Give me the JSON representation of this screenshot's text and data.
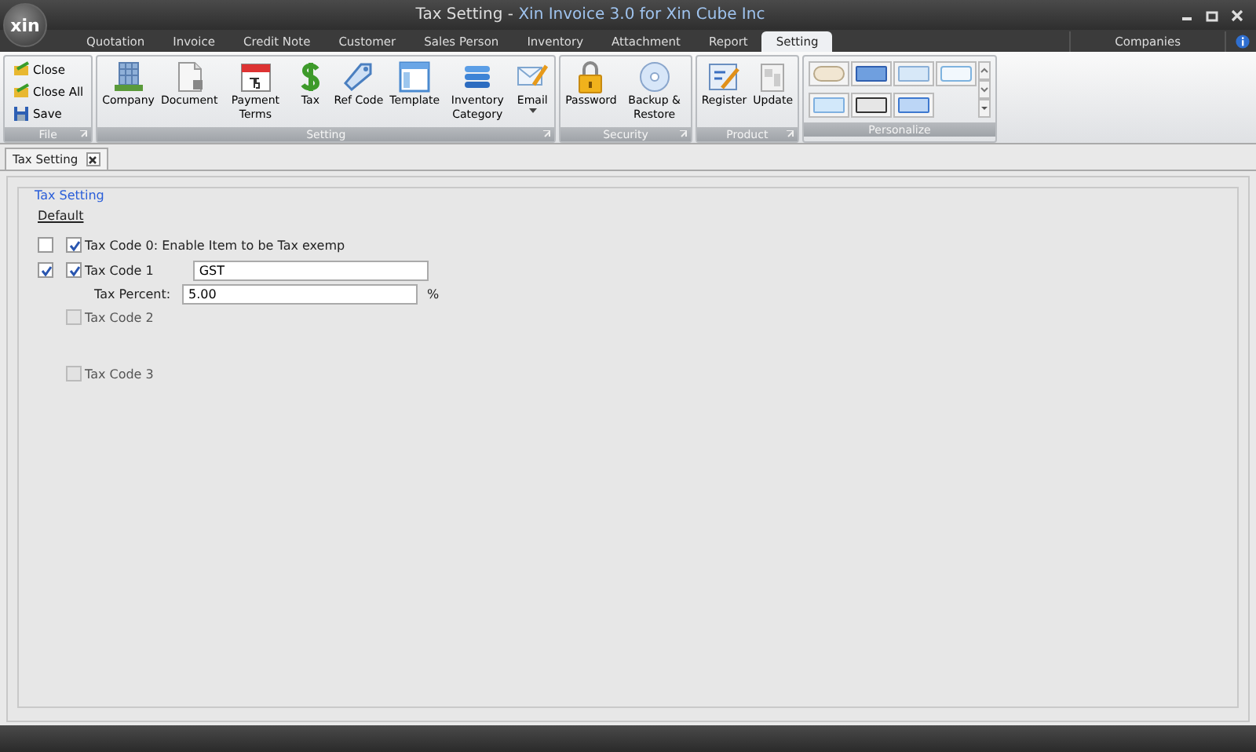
{
  "window": {
    "logo": "xin",
    "title_parts": [
      "Tax Setting - ",
      "Xin Invoice 3.0 for Xin Cube Inc"
    ]
  },
  "menu_tabs": [
    {
      "label": "Quotation",
      "selected": false
    },
    {
      "label": "Invoice",
      "selected": false
    },
    {
      "label": "Credit Note",
      "selected": false
    },
    {
      "label": "Customer",
      "selected": false
    },
    {
      "label": "Sales Person",
      "selected": false
    },
    {
      "label": "Inventory",
      "selected": false
    },
    {
      "label": "Attachment",
      "selected": false
    },
    {
      "label": "Report",
      "selected": false
    },
    {
      "label": "Setting",
      "selected": true
    }
  ],
  "companies_label": "Companies",
  "ribbon": {
    "file_group": {
      "label": "File",
      "items": [
        "Close",
        "Close All",
        "Save"
      ]
    },
    "groups": [
      {
        "label": "Setting",
        "buttons": [
          {
            "label": "Company"
          },
          {
            "label": "Document"
          },
          {
            "label": "Payment Terms"
          },
          {
            "label": "Tax"
          },
          {
            "label": "Ref Code"
          },
          {
            "label": "Template"
          },
          {
            "label": "Inventory Category"
          },
          {
            "label": "Email",
            "dropdown": true
          }
        ]
      },
      {
        "label": "Security",
        "buttons": [
          {
            "label": "Password"
          },
          {
            "label": "Backup & Restore"
          }
        ]
      },
      {
        "label": "Product",
        "buttons": [
          {
            "label": "Register"
          },
          {
            "label": "Update"
          }
        ]
      }
    ],
    "personalize": {
      "label": "Personalize"
    }
  },
  "document_tab": {
    "label": "Tax Setting"
  },
  "tax_setting": {
    "legend": "Tax Setting",
    "default_label": "Default",
    "codes": [
      {
        "default_checked": false,
        "checked": true,
        "label": "Tax Code 0: Enable Item to be Tax exemp"
      },
      {
        "default_checked": true,
        "checked": true,
        "label": "Tax Code 1",
        "name": "GST",
        "percent_label": "Tax Percent:",
        "percent": "5.00",
        "percent_unit": "%"
      },
      {
        "checked": false,
        "label": "Tax Code 2"
      },
      {
        "checked": false,
        "label": "Tax Code 3"
      }
    ]
  }
}
